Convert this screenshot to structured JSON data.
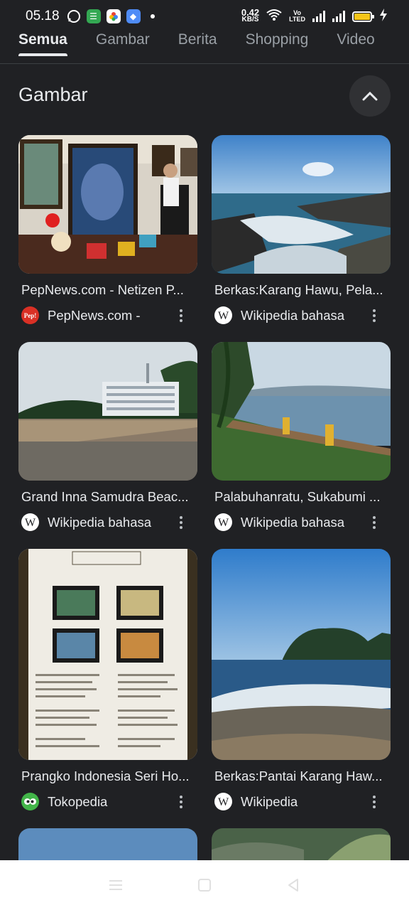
{
  "status_bar": {
    "time": "05.18",
    "speed_value": "0.42",
    "speed_unit": "KB/S",
    "volte_top": "Vo",
    "volte_bottom": "LTED"
  },
  "tabs": [
    {
      "label": "Semua",
      "active": true
    },
    {
      "label": "Gambar",
      "active": false
    },
    {
      "label": "Berita",
      "active": false
    },
    {
      "label": "Shopping",
      "active": false
    },
    {
      "label": "Video",
      "active": false
    }
  ],
  "section": {
    "title": "Gambar",
    "collapse_icon": "chevron-up-icon"
  },
  "results": [
    {
      "title": "PepNews.com - Netizen P...",
      "source": "PepNews.com -",
      "favicon": "pepnews-favicon",
      "thumb": "gallery-room-photo"
    },
    {
      "title": "Berkas:Karang Hawu, Pela...",
      "source": "Wikipedia bahasa",
      "favicon": "wikipedia-favicon",
      "thumb": "rocky-coast-photo"
    },
    {
      "title": "Grand Inna Samudra Beac...",
      "source": "Wikipedia bahasa",
      "favicon": "wikipedia-favicon",
      "thumb": "beach-hotel-photo"
    },
    {
      "title": "Palabuhanratu, Sukabumi ...",
      "source": "Wikipedia bahasa",
      "favicon": "wikipedia-favicon",
      "thumb": "bay-view-photo"
    },
    {
      "title": "Prangko Indonesia Seri Ho...",
      "source": "Tokopedia",
      "favicon": "tokopedia-favicon",
      "thumb": "stamp-sheet-photo"
    },
    {
      "title": "Berkas:Pantai Karang Haw...",
      "source": "Wikipedia",
      "favicon": "wikipedia-favicon",
      "thumb": "beach-island-photo"
    }
  ],
  "colors": {
    "background": "#202124",
    "text": "#e8eaed",
    "muted": "#9aa0a6",
    "pepnews": "#d93025",
    "tokopedia": "#42b549"
  }
}
